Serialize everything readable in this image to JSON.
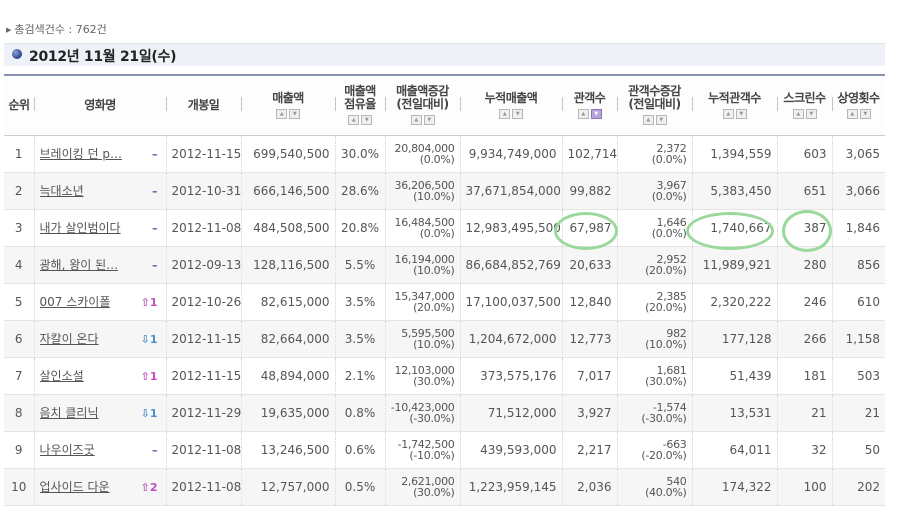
{
  "summary": {
    "label": "총검색건수 : 762건"
  },
  "date_header": {
    "label": "2012년 11월 21일(수)"
  },
  "columns": {
    "rank": "순위",
    "title": "영화명",
    "release": "개봉일",
    "sales": "매출액",
    "share_line1": "매출액",
    "share_line2": "점유율",
    "sales_change_line1": "매출액증감",
    "sales_change_line2": "(전일대비)",
    "cumulative_sales": "누적매출액",
    "audience": "관객수",
    "audience_change_line1": "관객수증감",
    "audience_change_line2": "(전일대비)",
    "cumulative_audience": "누적관객수",
    "screens": "스크린수",
    "shows": "상영횟수"
  },
  "icons": {
    "sort_up": "sort-up-icon",
    "sort_down": "sort-down-icon",
    "rank_same": "dash-icon",
    "rank_up": "up-arrow-icon",
    "rank_down": "down-arrow-icon"
  },
  "colors": {
    "rank_up": "#c050c0",
    "rank_down": "#4a90d0",
    "rank_same": "#4a5aa8",
    "highlight_circle": "#9bd89b"
  },
  "rows": [
    {
      "rank": "1",
      "title": "브레이킹 던 p…",
      "change": "–",
      "change_type": "same",
      "release": "2012-11-15",
      "sales": "699,540,500",
      "share": "30.0%",
      "sales_change": "20,804,000",
      "sales_change_pct": "(0.0%)",
      "cumulative_sales": "9,934,749,000",
      "audience": "102,714",
      "audience_change": "2,372",
      "audience_change_pct": "(0.0%)",
      "cumulative_audience": "1,394,559",
      "screens": "603",
      "shows": "3,065"
    },
    {
      "rank": "2",
      "title": "늑대소년",
      "change": "–",
      "change_type": "same",
      "release": "2012-10-31",
      "sales": "666,146,500",
      "share": "28.6%",
      "sales_change": "36,206,500",
      "sales_change_pct": "(10.0%)",
      "cumulative_sales": "37,671,854,000",
      "audience": "99,882",
      "audience_change": "3,967",
      "audience_change_pct": "(0.0%)",
      "cumulative_audience": "5,383,450",
      "screens": "651",
      "shows": "3,066"
    },
    {
      "rank": "3",
      "title": "내가 살인범이다",
      "change": "–",
      "change_type": "same",
      "release": "2012-11-08",
      "sales": "484,508,500",
      "share": "20.8%",
      "sales_change": "16,484,500",
      "sales_change_pct": "(0.0%)",
      "cumulative_sales": "12,983,495,500",
      "audience": "67,987",
      "audience_change": "1,646",
      "audience_change_pct": "(0.0%)",
      "cumulative_audience": "1,740,667",
      "screens": "387",
      "shows": "1,846"
    },
    {
      "rank": "4",
      "title": "광해, 왕이 된…",
      "change": "–",
      "change_type": "same",
      "release": "2012-09-13",
      "sales": "128,116,500",
      "share": "5.5%",
      "sales_change": "16,194,000",
      "sales_change_pct": "(10.0%)",
      "cumulative_sales": "86,684,852,769",
      "audience": "20,633",
      "audience_change": "2,952",
      "audience_change_pct": "(20.0%)",
      "cumulative_audience": "11,989,921",
      "screens": "280",
      "shows": "856"
    },
    {
      "rank": "5",
      "title": "007 스카이폴",
      "change": "1",
      "change_type": "up",
      "release": "2012-10-26",
      "sales": "82,615,000",
      "share": "3.5%",
      "sales_change": "15,347,000",
      "sales_change_pct": "(20.0%)",
      "cumulative_sales": "17,100,037,500",
      "audience": "12,840",
      "audience_change": "2,385",
      "audience_change_pct": "(20.0%)",
      "cumulative_audience": "2,320,222",
      "screens": "246",
      "shows": "610"
    },
    {
      "rank": "6",
      "title": "자칼이 온다",
      "change": "1",
      "change_type": "down",
      "release": "2012-11-15",
      "sales": "82,664,000",
      "share": "3.5%",
      "sales_change": "5,595,500",
      "sales_change_pct": "(10.0%)",
      "cumulative_sales": "1,204,672,000",
      "audience": "12,773",
      "audience_change": "982",
      "audience_change_pct": "(10.0%)",
      "cumulative_audience": "177,128",
      "screens": "266",
      "shows": "1,158"
    },
    {
      "rank": "7",
      "title": "살인소설",
      "change": "1",
      "change_type": "up",
      "release": "2012-11-15",
      "sales": "48,894,000",
      "share": "2.1%",
      "sales_change": "12,103,000",
      "sales_change_pct": "(30.0%)",
      "cumulative_sales": "373,575,176",
      "audience": "7,017",
      "audience_change": "1,681",
      "audience_change_pct": "(30.0%)",
      "cumulative_audience": "51,439",
      "screens": "181",
      "shows": "503"
    },
    {
      "rank": "8",
      "title": "음치 클리닉",
      "change": "1",
      "change_type": "down",
      "release": "2012-11-29",
      "sales": "19,635,000",
      "share": "0.8%",
      "sales_change": "-10,423,000",
      "sales_change_pct": "(-30.0%)",
      "cumulative_sales": "71,512,000",
      "audience": "3,927",
      "audience_change": "-1,574",
      "audience_change_pct": "(-30.0%)",
      "cumulative_audience": "13,531",
      "screens": "21",
      "shows": "21"
    },
    {
      "rank": "9",
      "title": "나우이즈굿",
      "change": "–",
      "change_type": "same",
      "release": "2012-11-08",
      "sales": "13,246,500",
      "share": "0.6%",
      "sales_change": "-1,742,500",
      "sales_change_pct": "(-10.0%)",
      "cumulative_sales": "439,593,000",
      "audience": "2,217",
      "audience_change": "-663",
      "audience_change_pct": "(-20.0%)",
      "cumulative_audience": "64,011",
      "screens": "32",
      "shows": "50"
    },
    {
      "rank": "10",
      "title": "업사이드 다운",
      "change": "2",
      "change_type": "up",
      "release": "2012-11-08",
      "sales": "12,757,000",
      "share": "0.5%",
      "sales_change": "2,621,000",
      "sales_change_pct": "(30.0%)",
      "cumulative_sales": "1,223,959,145",
      "audience": "2,036",
      "audience_change": "540",
      "audience_change_pct": "(40.0%)",
      "cumulative_audience": "174,322",
      "screens": "100",
      "shows": "202"
    }
  ]
}
